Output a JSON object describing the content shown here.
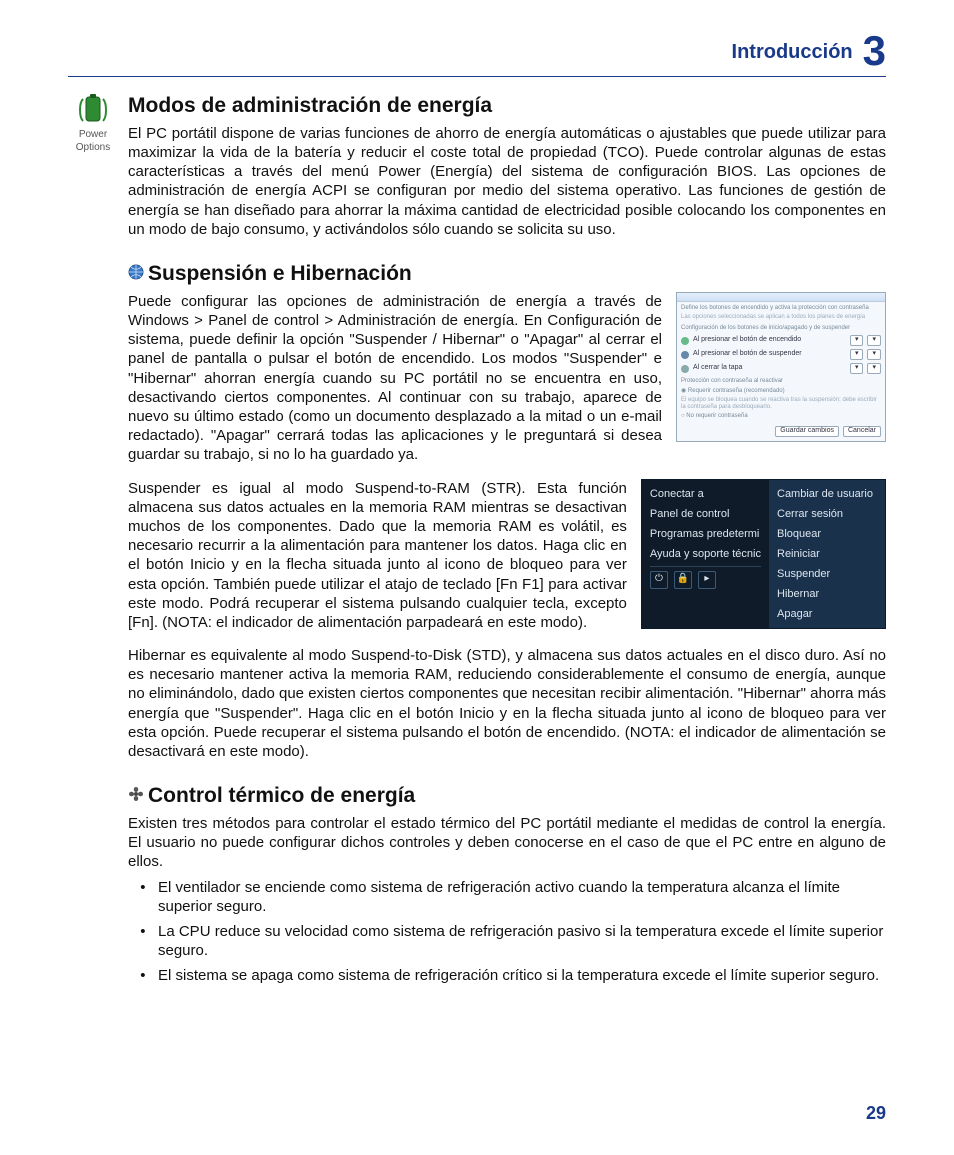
{
  "header": {
    "section_title": "Introducción",
    "chapter_number": "3"
  },
  "margin_icon": {
    "label": "Power Options"
  },
  "sections": {
    "power_modes": {
      "heading": "Modos de administración de energía",
      "body": "El PC portátil dispone de varias funciones de ahorro de energía automáticas o ajustables que puede utilizar para maximizar la vida de la batería y reducir el coste total de propiedad (TCO). Puede controlar algunas de estas características a través del menú Power (Energía) del sistema de configuración BIOS. Las opciones de administración de energía ACPI se configuran por medio del sistema operativo. Las funciones de gestión de energía se han diseñado para ahorrar la máxima cantidad de electricidad posible colocando los componentes en un modo de bajo consumo, y activándolos sólo cuando se solicita su uso."
    },
    "suspend": {
      "heading": "Suspensión e Hibernación",
      "p1": "Puede configurar las opciones de administración de energía a través de Windows > Panel de control > Administración de energía. En Configuración de sistema, puede definir la opción \"Suspender / Hibernar\" o \"Apagar\" al cerrar el panel de pantalla o pulsar el botón de encendido. Los modos \"Suspender\" e \"Hibernar\" ahorran energía cuando su PC portátil no se encuentra en uso, desactivando ciertos componentes. Al continuar con su trabajo, aparece de nuevo su último estado (como un documento desplazado a la mitad o un e-mail redactado). \"Apagar\" cerrará todas las aplicaciones y le preguntará si desea guardar su trabajo, si no lo ha guardado ya.",
      "p2": "Suspender es igual al modo Suspend-to-RAM (STR). Esta función almacena sus datos actuales en la memoria RAM mientras se desactivan muchos de los componentes. Dado que la memoria RAM es volátil, es necesario recurrir a la alimentación para mantener los datos. Haga clic en el botón Inicio y en la flecha situada junto al icono de bloqueo para ver esta opción. También puede utilizar el atajo de teclado [Fn F1] para activar este modo. Podrá recuperar el sistema pulsando cualquier tecla, excepto [Fn]. (NOTA: el indicador de alimentación parpadeará en este modo).",
      "p3": "Hibernar es equivalente al modo Suspend-to-Disk (STD), y almacena sus datos actuales en el disco duro. Así no es necesario mantener activa la memoria RAM, reduciendo considerablemente el consumo de energía, aunque no eliminándolo, dado que existen ciertos componentes que necesitan recibir alimentación. \"Hibernar\" ahorra más energía que \"Suspender\". Haga clic en el botón Inicio y en la flecha situada junto al icono de bloqueo para ver esta opción. Puede recuperar el sistema pulsando el botón de encendido. (NOTA: el indicador de alimentación se desactivará en este modo)."
    },
    "thermal": {
      "heading": "Control térmico de energía",
      "intro": "Existen tres métodos para controlar el estado térmico del PC portátil mediante el medidas de control la energía. El usuario no puede configurar dichos controles y deben conocerse en el caso de que el PC entre en alguno de ellos.",
      "bullets": [
        "El ventilador se enciende como sistema de refrigeración activo cuando la temperatura alcanza el límite superior seguro.",
        "La CPU reduce su velocidad como sistema de refrigeración pasivo si la temperatura excede el límite superior seguro.",
        "El sistema se apaga como sistema de refrigeración crítico si la temperatura excede el límite superior seguro."
      ]
    }
  },
  "startmenu": {
    "left": [
      "Conectar a",
      "Panel de control",
      "Programas predetermi",
      "Ayuda y soporte técnic"
    ],
    "right": [
      "Cambiar de usuario",
      "Cerrar sesión",
      "Bloquear",
      "Reiniciar",
      "Suspender",
      "Hibernar",
      "Apagar"
    ]
  },
  "page_number": "29"
}
